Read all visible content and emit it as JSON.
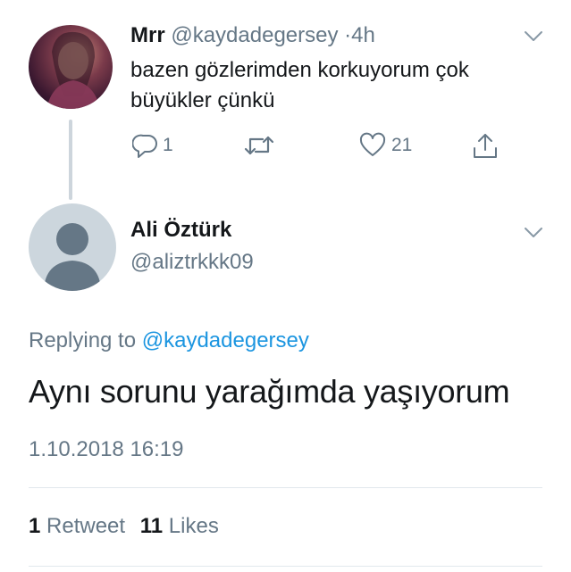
{
  "reply_context_tweet": {
    "author_name": "Mrr",
    "author_handle": "@kaydadegersey",
    "separator": "·",
    "time_ago": "4h",
    "text": "bazen gözlerimden korkuyorum çok büyükler çünkü",
    "reply_count": "1",
    "retweet_count": "",
    "like_count": "21"
  },
  "main_tweet": {
    "author_name": "Ali Öztürk",
    "author_handle": "@aliztrkkk09",
    "replying_label": "Replying to",
    "replying_handle": "@kaydadegersey",
    "text": "Aynı sorunu yarağımda yaşıyorum",
    "timestamp": "1.10.2018 16:19",
    "retweets_count": "1",
    "retweets_label": "Retweet",
    "likes_count": "11",
    "likes_label": "Likes"
  },
  "icons": {
    "reply": "reply-icon",
    "retweet": "retweet-icon",
    "like": "heart-icon",
    "share": "share-icon",
    "menu": "chevron-down-icon"
  },
  "colors": {
    "text_primary": "#14171a",
    "text_secondary": "#657786",
    "link": "#1b95e0",
    "divider": "#e1e8ed",
    "thread_line": "#cdd5dc"
  }
}
